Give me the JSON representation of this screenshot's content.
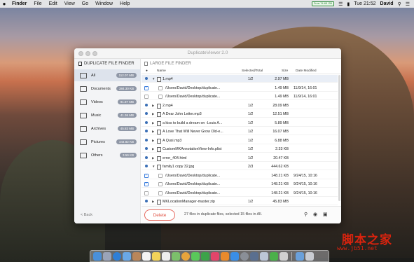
{
  "menubar": {
    "apple": "",
    "items": [
      "Finder",
      "File",
      "Edit",
      "View",
      "Go",
      "Window",
      "Help"
    ],
    "status_badge": "Free:74.65 GB",
    "clock": "Tue 21:52",
    "user": "David"
  },
  "window": {
    "title": "DuplicateViewer 2.0",
    "mode_duplicate": "DUPLICATE FILE FINDER",
    "mode_large": "LARGE FILE FINDER"
  },
  "sidebar": {
    "items": [
      {
        "label": "All",
        "size": "112.07 MB",
        "icon": "folder-icon",
        "selected": true
      },
      {
        "label": "Documents",
        "size": "384.30 KB",
        "icon": "document-icon"
      },
      {
        "label": "Videos",
        "size": "91.87 MB",
        "icon": "video-icon"
      },
      {
        "label": "Music",
        "size": "41.36 MB",
        "icon": "music-icon"
      },
      {
        "label": "Archives",
        "size": "45.83 MB",
        "icon": "archive-icon"
      },
      {
        "label": "Pictures",
        "size": "444.82 KB",
        "icon": "picture-icon"
      },
      {
        "label": "Others",
        "size": "3.59 KB",
        "icon": "others-icon"
      }
    ],
    "back": "Back"
  },
  "table": {
    "columns": {
      "name": "Name",
      "selected": "Selected/Total",
      "size": "Size",
      "date": "Date Modified"
    },
    "rows": [
      {
        "name": "1.mp4",
        "selected": "1/2",
        "size": "2.97 MB",
        "date": "",
        "group": true,
        "expanded": true,
        "dot": true,
        "checked": false,
        "highlight": true
      },
      {
        "name": "/Users/David/Desktop/duplicate...",
        "selected": "",
        "size": "1.49 MB",
        "date": "11/9/14, 16:01",
        "group": false,
        "checked": true
      },
      {
        "name": "/Users/David/Desktop/duplicate...",
        "selected": "",
        "size": "1.49 MB",
        "date": "11/9/14, 16:01",
        "group": false,
        "checked": false
      },
      {
        "name": "2.mp4",
        "selected": "1/2",
        "size": "28.09 MB",
        "date": "",
        "group": true,
        "expanded": false,
        "dot": true
      },
      {
        "name": "A Dear John Letter.mp3",
        "selected": "1/2",
        "size": "12.51 MB",
        "date": "",
        "group": true,
        "expanded": false,
        "dot": true
      },
      {
        "name": "a kiss to build a dream on -Louis A...",
        "selected": "1/2",
        "size": "5.89 MB",
        "date": "",
        "group": true,
        "expanded": false,
        "dot": true
      },
      {
        "name": "A Love That Will Never Grow Old-e...",
        "selected": "1/2",
        "size": "16.07 MB",
        "date": "",
        "group": true,
        "expanded": false,
        "dot": true
      },
      {
        "name": "A Qusi.mp3",
        "selected": "1/2",
        "size": "6.88 MB",
        "date": "",
        "group": true,
        "expanded": false,
        "dot": true
      },
      {
        "name": "CustomMKAnnotationView-Info.plist",
        "selected": "1/2",
        "size": "2.33 KB",
        "date": "",
        "group": true,
        "expanded": false,
        "dot": true
      },
      {
        "name": "error_404.html",
        "selected": "1/2",
        "size": "20.47 KB",
        "date": "",
        "group": true,
        "expanded": false,
        "dot": true
      },
      {
        "name": "family1 copy 32.jpg",
        "selected": "2/3",
        "size": "444.62 KB",
        "date": "",
        "group": true,
        "expanded": true,
        "dot": true
      },
      {
        "name": "/Users/David/Desktop/duplicate...",
        "selected": "",
        "size": "148.21 KB",
        "date": "9/24/15, 10:16",
        "group": false,
        "checked": true
      },
      {
        "name": "/Users/David/Desktop/duplicate...",
        "selected": "",
        "size": "148.21 KB",
        "date": "9/24/15, 10:16",
        "group": false,
        "checked": true
      },
      {
        "name": "/Users/David/Desktop/duplicate...",
        "selected": "",
        "size": "148.21 KB",
        "date": "9/24/15, 10:16",
        "group": false,
        "checked": false
      },
      {
        "name": "MKLocationManager-master.zip",
        "selected": "1/2",
        "size": "45.83 MB",
        "date": "",
        "group": true,
        "expanded": false,
        "dot": true
      }
    ]
  },
  "bottombar": {
    "delete": "Delete",
    "status": "27 files in duplicate files, selected 15 files in All."
  },
  "watermark": {
    "line1": "脚本之家",
    "line2": "www.jb51.net"
  },
  "colors": {
    "accent": "#3b6fb6",
    "delete": "#e05345",
    "watermark": "#d8230e"
  }
}
